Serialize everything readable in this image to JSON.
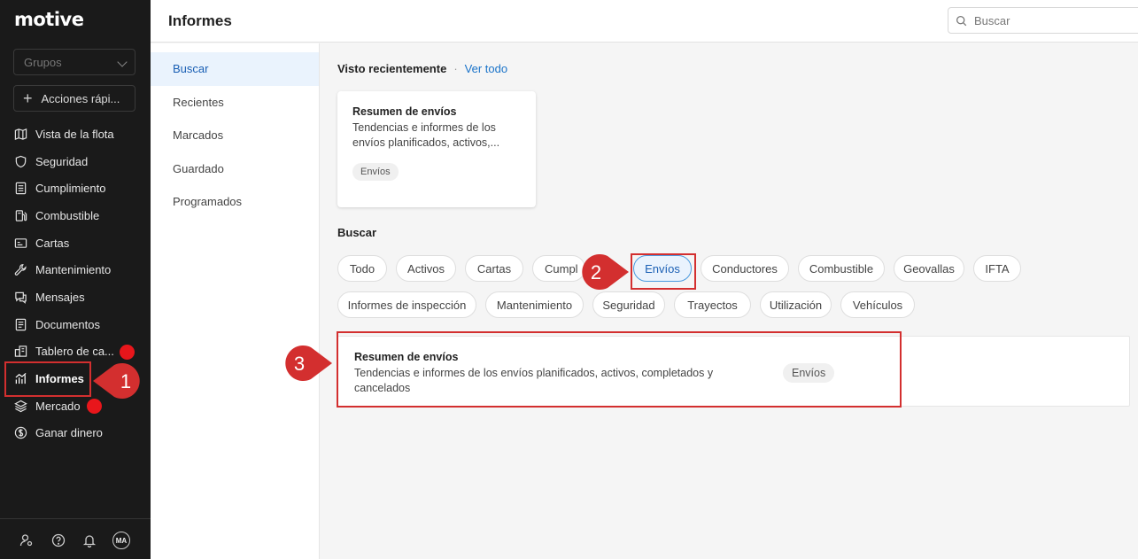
{
  "app": {
    "logo": "motive",
    "page_title": "Informes"
  },
  "sidebar": {
    "groups_placeholder": "Grupos",
    "quick_actions": "Acciones rápi...",
    "items": [
      {
        "label": "Vista de la flota",
        "icon": "map-icon"
      },
      {
        "label": "Seguridad",
        "icon": "shield-icon"
      },
      {
        "label": "Cumplimiento",
        "icon": "document-icon"
      },
      {
        "label": "Combustible",
        "icon": "fuel-icon"
      },
      {
        "label": "Cartas",
        "icon": "card-icon"
      },
      {
        "label": "Mantenimiento",
        "icon": "wrench-icon"
      },
      {
        "label": "Mensajes",
        "icon": "messages-icon"
      },
      {
        "label": "Documentos",
        "icon": "documents-icon"
      },
      {
        "label": "Tablero de ca...",
        "icon": "board-icon"
      },
      {
        "label": "Informes",
        "icon": "reports-icon"
      },
      {
        "label": "Mercado",
        "icon": "layers-icon"
      },
      {
        "label": "Ganar dinero",
        "icon": "dollar-icon"
      }
    ],
    "avatar_initials": "MA"
  },
  "header": {
    "search_placeholder": "Buscar"
  },
  "subnav": {
    "items": [
      "Buscar",
      "Recientes",
      "Marcados",
      "Guardado",
      "Programados"
    ]
  },
  "recent": {
    "heading": "Visto recientemente",
    "view_all": "Ver todo",
    "card": {
      "title": "Resumen de envíos",
      "desc": "Tendencias e informes de los envíos planificados, activos,...",
      "tag": "Envíos"
    }
  },
  "search": {
    "heading": "Buscar",
    "chips": [
      "Todo",
      "Activos",
      "Cartas",
      "Cumpl",
      "Envíos",
      "Conductores",
      "Combustible",
      "Geovallas",
      "IFTA",
      "Informes de inspección",
      "Mantenimiento",
      "Seguridad",
      "Trayectos",
      "Utilización",
      "Vehículos"
    ],
    "selected_chip": "Envíos"
  },
  "result": {
    "title": "Resumen de envíos",
    "desc": "Tendencias e informes de los envíos planificados, activos, completados y cancelados",
    "tag": "Envíos"
  },
  "annotations": {
    "step1": "1",
    "step2": "2",
    "step3": "3",
    "color": "#d32f2f"
  }
}
